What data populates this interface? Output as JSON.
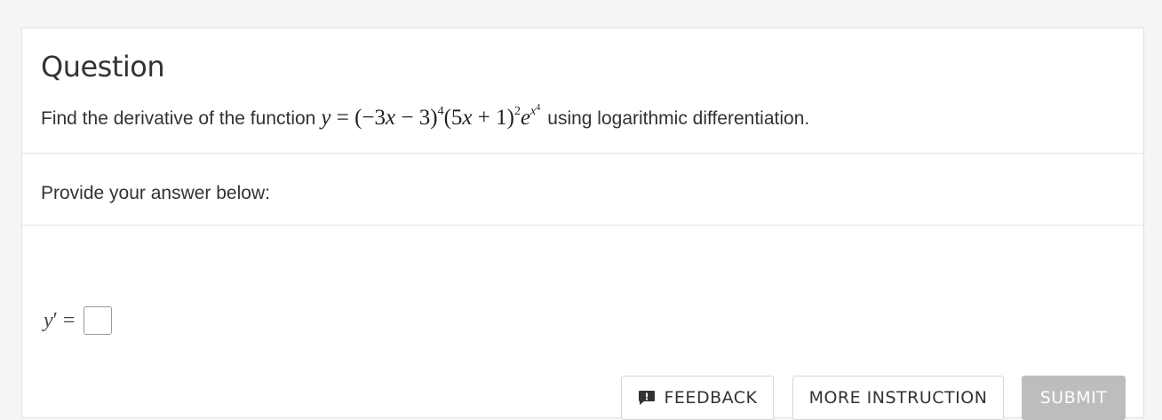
{
  "question": {
    "title": "Question",
    "prefix": "Find the derivative of the function",
    "suffix": "using logarithmic differentiation.",
    "math": {
      "y": "y",
      "eq": "=",
      "term1": "(−3",
      "x1": "x",
      "term1b": " − 3)",
      "exp1": "4",
      "term2": "(5",
      "x2": "x",
      "term2b": " + 1)",
      "exp2": "2",
      "e": "e",
      "ex": "x",
      "ex_exp": "4"
    }
  },
  "prompt": {
    "text": "Provide your answer below:"
  },
  "answer": {
    "label_y": "y",
    "prime": "′",
    "eq": "=",
    "value": ""
  },
  "buttons": {
    "feedback": "FEEDBACK",
    "more_instruction": "MORE INSTRUCTION",
    "submit": "SUBMIT"
  },
  "colors": {
    "submit_bg": "#bdbdbd",
    "page_bg": "#f5f5f5",
    "feedback_icon": "#333333"
  },
  "icons": {
    "feedback": "feedback-icon"
  }
}
